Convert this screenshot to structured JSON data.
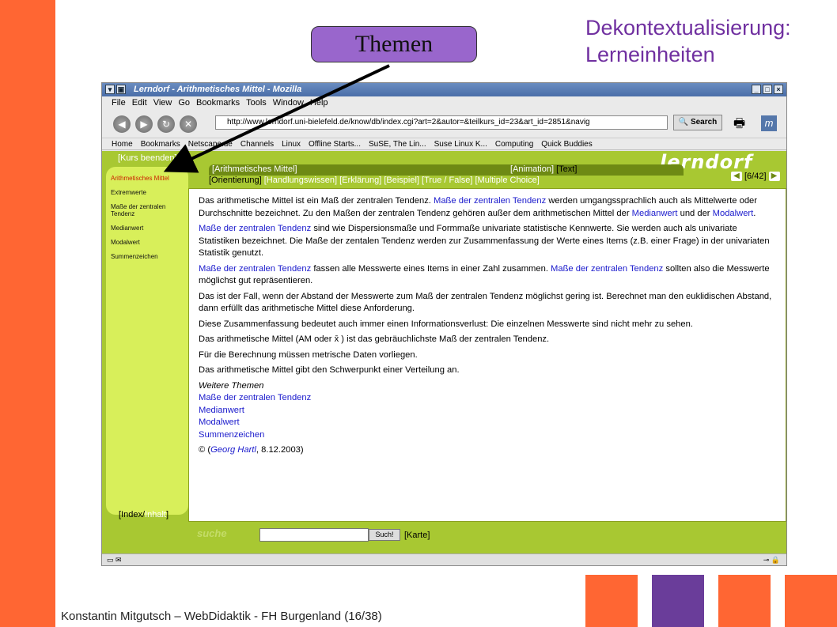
{
  "slide": {
    "title_line1": "Dekontextualisierung:",
    "title_line2": "Lerneinheiten",
    "themen_label": "Themen",
    "footer": "Konstantin Mitgutsch – WebDidaktik - FH Burgenland  (16/38)",
    "colors": {
      "orange": "#ff6633",
      "purple": "#7030a0",
      "box_purple": "#9966cc",
      "deco_purple": "#6a3d9a"
    }
  },
  "browser": {
    "window_title": "Lerndorf - Arithmetisches Mittel - Mozilla",
    "menu": [
      "File",
      "Edit",
      "View",
      "Go",
      "Bookmarks",
      "Tools",
      "Window",
      "Help"
    ],
    "url": "http://www.lerndorf.uni-bielefeld.de/know/db/index.cgi?art=2&autor=&teilkurs_id=23&art_id=2851&navig",
    "search_label": "Search",
    "bookmarks": [
      "Home",
      "Bookmarks",
      "Netscape.de",
      "Channels",
      "Linux",
      "Offline Starts...",
      "SuSE, The Lin...",
      "Suse Linux K...",
      "Computing",
      "Quick Buddies"
    ],
    "icons": [
      "back-icon",
      "forward-icon",
      "reload-icon",
      "stop-icon",
      "print-icon",
      "mozilla-icon"
    ]
  },
  "page": {
    "logo": "lerndorf",
    "kurs_beenden": "[Kurs beenden]",
    "sidebar": [
      {
        "label": "Arithmetisches Mittel",
        "active": true
      },
      {
        "label": "Extremwerte",
        "active": false
      },
      {
        "label": "Maße der zentralen Tendenz",
        "active": false
      },
      {
        "label": "Medianwert",
        "active": false
      },
      {
        "label": "Modalwert",
        "active": false
      },
      {
        "label": "Summenzeichen",
        "active": false
      }
    ],
    "crumb": "[Arithmetisches Mittel]",
    "anim_link": "[Animation]",
    "text_link": "[Text]",
    "tabs": {
      "orientierung": "[Orientierung]",
      "rest": "[Handlungswissen] [Erklärung] [Beispiel] [True / False] [Multiple Choice]"
    },
    "pager": "[6/42]",
    "paragraphs": {
      "p1a": "Das arithmetische Mittel ist ein Maß der zentralen Tendenz. ",
      "p1link": "Maße der zentralen Tendenz",
      "p1b": " werden umgangssprachlich auch als Mittelwerte oder Durchschnitte bezeichnet. Zu den Maßen der zentralen Tendenz gehören außer dem arithmetischen Mittel der ",
      "p1link2": "Medianwert",
      "p1c": " und der ",
      "p1link3": "Modalwert",
      "p1d": ".",
      "p2link": "Maße der zentralen Tendenz",
      "p2": " sind wie Dispersionsmaße und Formmaße univariate statistische Kennwerte. Sie werden auch als univariate Statistiken bezeichnet. Die Maße der zentalen Tendenz werden zur Zusammenfassung der Werte eines Items (z.B. einer Frage) in der univariaten Statistik genutzt.",
      "p3link": "Maße der zentralen Tendenz",
      "p3a": " fassen alle Messwerte eines Items in einer Zahl zusammen. ",
      "p3link2": "Maße der zentralen Tendenz",
      "p3b": " sollten also die Messwerte möglichst gut repräsentieren.",
      "p4": "Das ist der Fall, wenn der Abstand der Messwerte zum Maß der zentralen Tendenz möglichst gering ist. Berechnet man den euklidischen Abstand, dann erfüllt das arithmetische Mittel diese Anforderung.",
      "p5": "Diese Zusammenfassung bedeutet auch immer einen Informationsverlust: Die einzelnen Messwerte sind nicht mehr zu sehen.",
      "p6a": " Das arithmetische Mittel (AM oder ",
      "p6sym": "x̄",
      "p6b": " ) ist das gebräuchlichste Maß der zentralen Tendenz.",
      "p7": "Für die Berechnung müssen metrische Daten vorliegen.",
      "p8": "Das arithmetische Mittel gibt den Schwerpunkt einer Verteilung an.",
      "weitere": "Weitere Themen",
      "weitere_links": [
        "Maße der zentralen Tendenz",
        "Medianwert",
        "Modalwert",
        "Summenzeichen"
      ],
      "copy_a": "© (",
      "copy_link": "Georg Hartl",
      "copy_b": ", 8.12.2003)"
    },
    "index_link": "[Index/",
    "inhalt_link": "Inhalt",
    "index_close": "]",
    "suche": "suche",
    "such_button": "Such!",
    "karte": "[Karte]"
  }
}
